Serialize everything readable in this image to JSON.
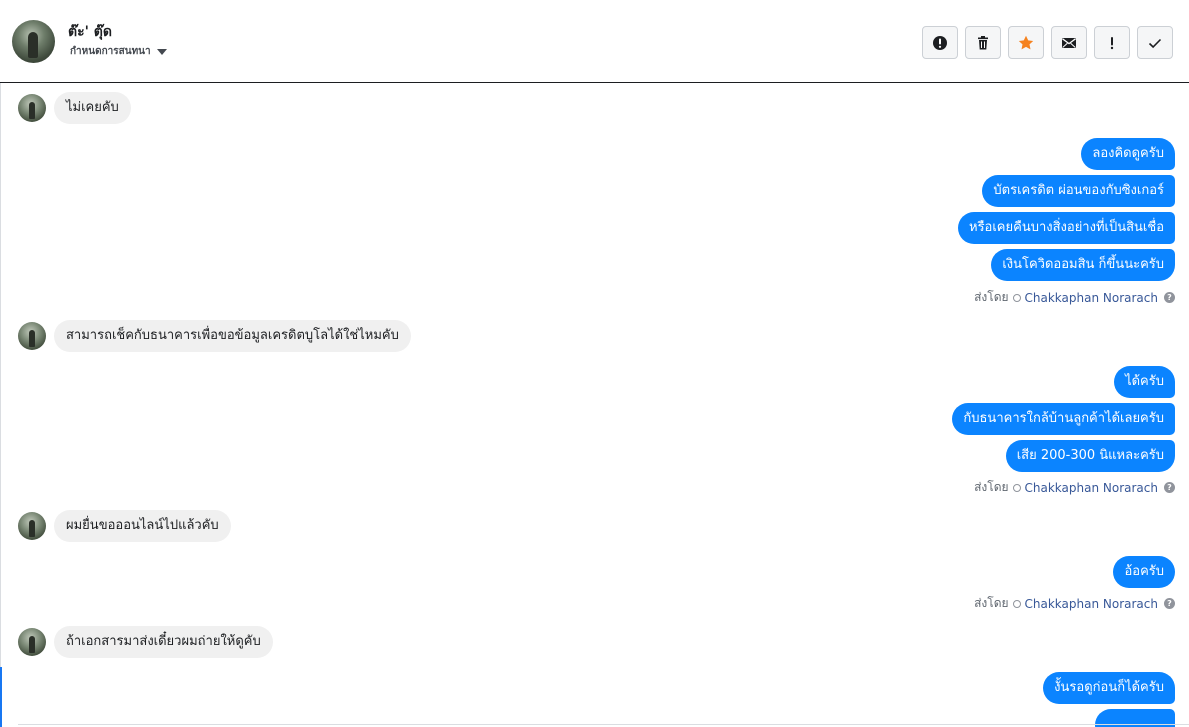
{
  "header": {
    "contact_name": "ต๊ะ' ตุ๊ด",
    "contact_sub": "กำหนดการสนทนา"
  },
  "toolbar": [
    {
      "name": "alert-button",
      "icon": "alert-circle-icon"
    },
    {
      "name": "delete-button",
      "icon": "trash-icon"
    },
    {
      "name": "star-button",
      "icon": "star-icon",
      "color": "#f5821f"
    },
    {
      "name": "mail-button",
      "icon": "envelope-icon"
    },
    {
      "name": "spam-button",
      "icon": "exclamation-icon"
    },
    {
      "name": "done-button",
      "icon": "check-icon"
    }
  ],
  "messages": {
    "in1": "ไม่เคยคับ",
    "out1": [
      "ลองคิดดูครับ",
      "บัตรเครดิต ผ่อนของกับซิงเกอร์",
      "หรือเคยคืนบางสิ่งอย่างที่เป็นสินเชื่อ",
      "เงินโควิดออมสิน ก็ขึ้นนะครับ"
    ],
    "in2": "สามารถเช็คกับธนาคารเพื่อขอข้อมูลเครดิตบูโลได้ใช่ไหมคับ",
    "out2": [
      "ได้ครับ",
      "กับธนาคารใกล้บ้านลูกค้าได้เลยครับ",
      "เสีย 200-300 นิแหละครับ"
    ],
    "in3": "ผมยื่นขอออนไลน์ไปแล้วคับ",
    "out3": [
      "อ้อครับ"
    ],
    "in4": "ถ้าเอกสารมาส่งเดี๋ยวผมถ่ายให้ดูคับ",
    "out4": [
      "งั้นรอดูก่อนก็ได้ครับ"
    ]
  },
  "sent_by": {
    "prefix": "ส่งโดย",
    "agent": "Chakkaphan Norarach",
    "help": "?"
  },
  "colors": {
    "outgoing_bubble": "#0b84ff",
    "incoming_bubble": "#f0f0f0",
    "agent_link": "#385898"
  }
}
